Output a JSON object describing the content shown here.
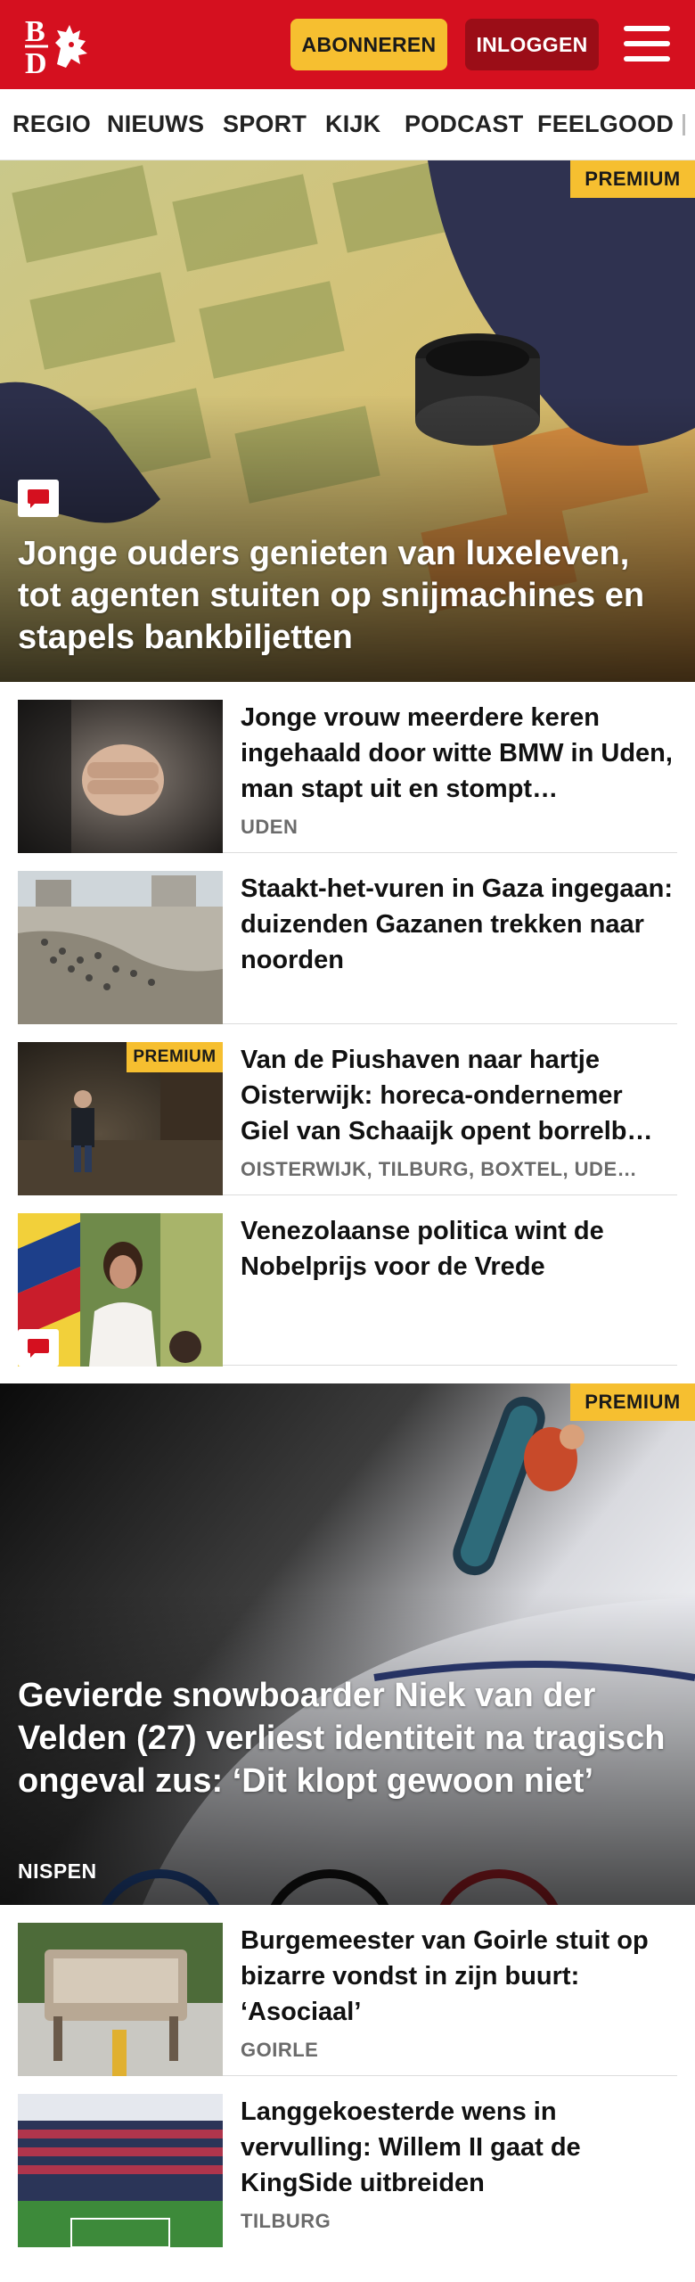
{
  "header": {
    "logo_text": "BD",
    "subscribe_label": "ABONNEREN",
    "login_label": "INLOGGEN",
    "brand_color": "#d5101f",
    "accent_color": "#f6bf30"
  },
  "nav": {
    "items": [
      "REGIO",
      "NIEUWS",
      "SPORT",
      "KIJK",
      "PODCAST",
      "FEELGOOD"
    ]
  },
  "hero": {
    "badge": "PREMIUM",
    "title": "Jonge ouders genieten van luxeleven, tot agenten stuiten op snijmachines en stapels bankbiljetten",
    "icon": "comment-icon"
  },
  "articles": [
    {
      "title": "Jonge vrouw meerdere keren ingehaald door witte BMW in Uden, man stapt uit en stompt…",
      "location": "UDEN"
    },
    {
      "title": "Staakt-het-vuren in Gaza ingegaan: duizenden Gazanen trekken naar noorden",
      "location": ""
    },
    {
      "title": "Van de Piushaven naar hartje Oisterwijk: horeca-ondernemer Giel van Schaaijk opent borrelb…",
      "location": "OISTERWIJK, TILBURG, BOXTEL, UDE…",
      "badge": "PREMIUM"
    },
    {
      "title": "Venezolaanse politica wint de Nobelprijs voor de Vrede",
      "location": ""
    }
  ],
  "feature": {
    "badge": "PREMIUM",
    "title": "Gevierde snowboarder Niek van der Velden (27) verliest identiteit na tragisch ongeval zus: ‘Dit klopt gewoon niet’",
    "location": "NISPEN"
  },
  "articles2": [
    {
      "title": "Burgemeester van Goirle stuit op bizarre vondst in zijn buurt: ‘Asociaal’",
      "location": "GOIRLE"
    },
    {
      "title": "Langgekoesterde wens in vervulling: Willem II gaat de KingSide uitbreiden",
      "location": "TILBURG"
    }
  ]
}
